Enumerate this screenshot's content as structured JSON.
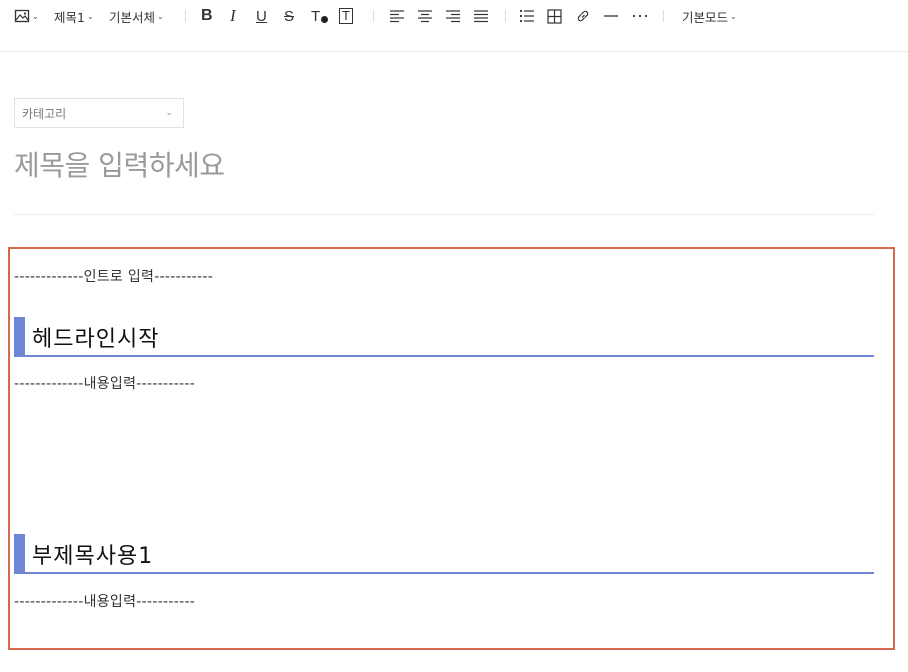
{
  "toolbar": {
    "image_icon": "image-icon",
    "heading_style": "제목1",
    "font_family": "기본서체",
    "bold": "B",
    "italic": "I",
    "underline": "U",
    "strike": "S",
    "text_color": "T",
    "text_bg": "T",
    "mode": "기본모드"
  },
  "category": {
    "label": "카테고리"
  },
  "title": {
    "placeholder": "제목을 입력하세요"
  },
  "content": {
    "intro": "-------------인트로 입력-----------",
    "heading1": "헤드라인시작",
    "body1": "-------------내용입력-----------",
    "heading2": "부제목사용1",
    "body2": "-------------내용입력-----------"
  },
  "colors": {
    "heading_accent": "#6f86d4",
    "frame_border": "#d46a4b"
  }
}
